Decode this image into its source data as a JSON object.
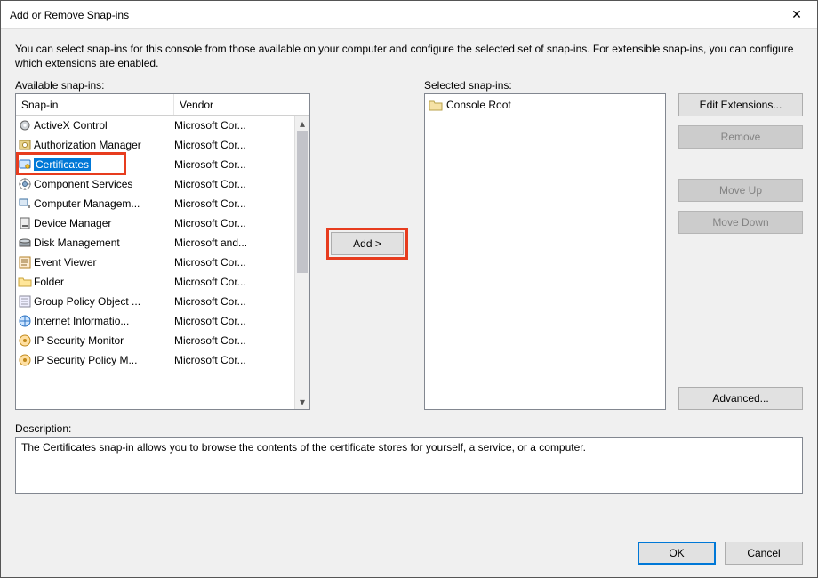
{
  "window": {
    "title": "Add or Remove Snap-ins",
    "close_glyph": "✕"
  },
  "intro": "You can select snap-ins for this console from those available on your computer and configure the selected set of snap-ins. For extensible snap-ins, you can configure which extensions are enabled.",
  "labels": {
    "available": "Available snap-ins:",
    "selected": "Selected snap-ins:",
    "description": "Description:"
  },
  "columns": {
    "snapin": "Snap-in",
    "vendor": "Vendor"
  },
  "available": [
    {
      "name": "ActiveX Control",
      "vendor": "Microsoft Cor...",
      "icon": "gear"
    },
    {
      "name": "Authorization Manager",
      "vendor": "Microsoft Cor...",
      "icon": "authz"
    },
    {
      "name": "Certificates",
      "vendor": "Microsoft Cor...",
      "icon": "cert",
      "selected": true
    },
    {
      "name": "Component Services",
      "vendor": "Microsoft Cor...",
      "icon": "comp"
    },
    {
      "name": "Computer Managem...",
      "vendor": "Microsoft Cor...",
      "icon": "pc"
    },
    {
      "name": "Device Manager",
      "vendor": "Microsoft Cor...",
      "icon": "device"
    },
    {
      "name": "Disk Management",
      "vendor": "Microsoft and...",
      "icon": "disk"
    },
    {
      "name": "Event Viewer",
      "vendor": "Microsoft Cor...",
      "icon": "event"
    },
    {
      "name": "Folder",
      "vendor": "Microsoft Cor...",
      "icon": "folder"
    },
    {
      "name": "Group Policy Object ...",
      "vendor": "Microsoft Cor...",
      "icon": "gpo"
    },
    {
      "name": "Internet Informatio...",
      "vendor": "Microsoft Cor...",
      "icon": "iis"
    },
    {
      "name": "IP Security Monitor",
      "vendor": "Microsoft Cor...",
      "icon": "ipmon"
    },
    {
      "name": "IP Security Policy M...",
      "vendor": "Microsoft Cor...",
      "icon": "ippol"
    }
  ],
  "available_selected_index": 2,
  "add_button": "Add >",
  "selected_root": "Console Root",
  "actions": {
    "edit_ext": "Edit Extensions...",
    "remove": "Remove",
    "move_up": "Move Up",
    "move_down": "Move Down",
    "advanced": "Advanced..."
  },
  "description_text": "The Certificates snap-in allows you to browse the contents of the certificate stores for yourself, a service, or a computer.",
  "footer": {
    "ok": "OK",
    "cancel": "Cancel"
  },
  "scroll": {
    "up": "▴",
    "down": "▾"
  }
}
